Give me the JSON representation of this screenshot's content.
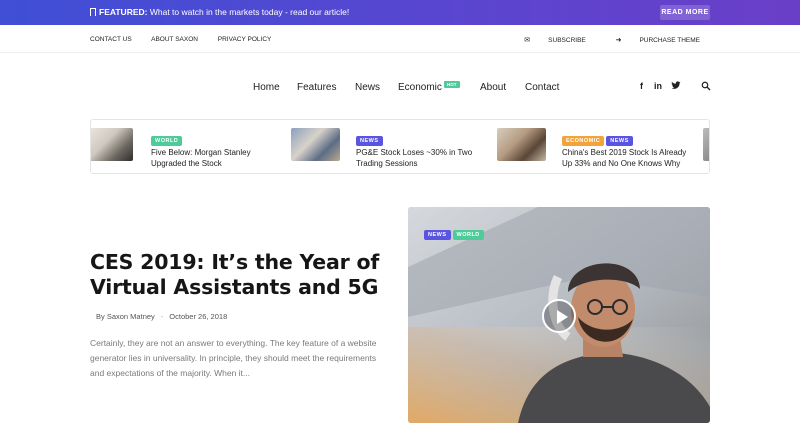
{
  "featured": {
    "label": "FEATURED:",
    "text": " What to watch in the markets today  - read our article!",
    "button": "READ MORE"
  },
  "subnav": {
    "left": [
      "CONTACT US",
      "ABOUT SAXON",
      "PRIVACY POLICY"
    ],
    "subscribe": "SUBSCRIBE",
    "purchase": "PURCHASE THEME"
  },
  "nav": {
    "items": [
      "Home",
      "Features",
      "News",
      "Economic",
      "About",
      "Contact"
    ],
    "hot_badge": "HOT"
  },
  "ticker": [
    {
      "tags": [
        "WORLD"
      ],
      "title": "Five Below: Morgan Stanley Upgraded the Stock"
    },
    {
      "tags": [
        "NEWS"
      ],
      "title": "PG&E Stock Loses ~30% in Two Trading Sessions"
    },
    {
      "tags": [
        "ECONOMIC",
        "NEWS"
      ],
      "title": "China's Best 2019 Stock Is Already Up 33% and No One Knows Why"
    }
  ],
  "hero": {
    "title": "CES 2019: It’s the Year of Virtual Assistants and 5G",
    "author": "By Saxon Matney",
    "date": "October 26, 2018",
    "excerpt": "Certainly, they are not an answer to everything. The key feature of a website generator lies in universality. In principle, they should meet the requirements and expectations of the majority. When it...",
    "tags": [
      "NEWS",
      "WORLD"
    ]
  },
  "colors": {
    "tag_world": "#4ecb9b",
    "tag_news": "#5a55e0",
    "tag_economic": "#f2a33a"
  }
}
